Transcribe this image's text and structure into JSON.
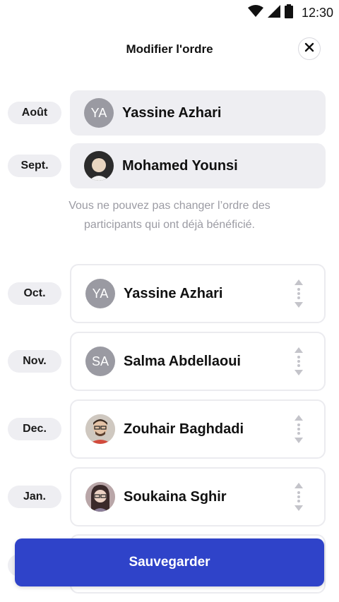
{
  "status": {
    "time": "12:30"
  },
  "header": {
    "title": "Modifier l'ordre"
  },
  "locked_rows": [
    {
      "month": "Août",
      "name": "Yassine Azhari",
      "initials": "YA",
      "avatar": "initials"
    },
    {
      "month": "Sept.",
      "name": "Mohamed Younsi",
      "initials": "",
      "avatar": "photo"
    }
  ],
  "note": "Vous ne pouvez pas changer l’ordre des participants qui ont déjà bénéficié.",
  "movable_rows": [
    {
      "month": "Oct.",
      "name": "Yassine Azhari",
      "initials": "YA",
      "avatar": "initials"
    },
    {
      "month": "Nov.",
      "name": "Salma Abdellaoui",
      "initials": "SA",
      "avatar": "initials"
    },
    {
      "month": "Dec.",
      "name": "Zouhair Baghdadi",
      "initials": "",
      "avatar": "photo"
    },
    {
      "month": "Jan.",
      "name": "Soukaina Sghir",
      "initials": "",
      "avatar": "photo"
    }
  ],
  "save_button": {
    "label": "Sauvegarder"
  },
  "colors": {
    "primary": "#2f43c9",
    "pill_bg": "#eeeef2",
    "muted_text": "#9b9ba3"
  },
  "icons": {
    "wifi": "wifi-icon",
    "signal": "signal-icon",
    "battery": "battery-icon",
    "close": "close-icon",
    "drag": "drag-handle-icon"
  }
}
